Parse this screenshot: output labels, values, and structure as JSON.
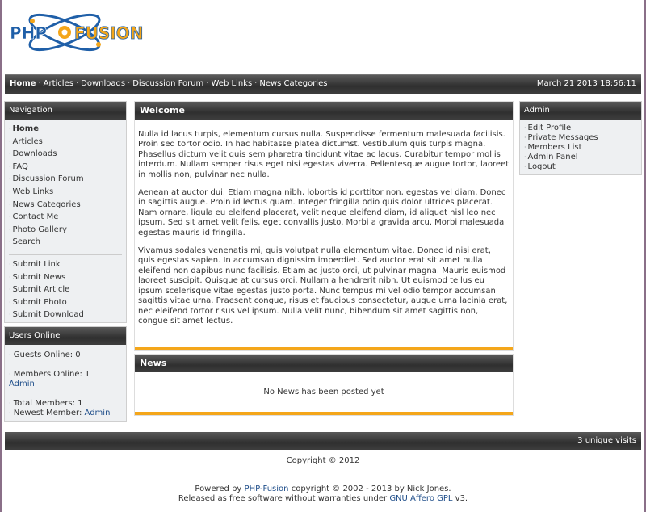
{
  "logo": {
    "part1": "PHP",
    "part2": "FUSION",
    "icon": "atom-logo-icon"
  },
  "topbar": {
    "links": [
      "Home",
      "Articles",
      "Downloads",
      "Discussion Forum",
      "Web Links",
      "News Categories"
    ],
    "date": "March 21 2013 18:56:11"
  },
  "navigation": {
    "title": "Navigation",
    "items": [
      "Home",
      "Articles",
      "Downloads",
      "FAQ",
      "Discussion Forum",
      "Web Links",
      "News Categories",
      "Contact Me",
      "Photo Gallery",
      "Search"
    ],
    "submit_items": [
      "Submit Link",
      "Submit News",
      "Submit Article",
      "Submit Photo",
      "Submit Download"
    ]
  },
  "users_online": {
    "title": "Users Online",
    "guests": "Guests Online: 0",
    "members": "Members Online: 1",
    "member_name": "Admin",
    "total": "Total Members: 1",
    "newest_label": "Newest Member:",
    "newest_name": "Admin"
  },
  "welcome": {
    "title": "Welcome",
    "paragraphs": [
      "Nulla id lacus turpis, elementum cursus nulla. Suspendisse fermentum malesuada facilisis. Proin sed tortor odio. In hac habitasse platea dictumst. Vestibulum quis turpis magna. Phasellus dictum velit quis sem pharetra tincidunt vitae ac lacus. Curabitur tempor mollis interdum. Nullam semper risus eget nisi egestas viverra. Pellentesque augue tortor, laoreet in mollis non, pulvinar nec nulla.",
      "Aenean at auctor dui. Etiam magna nibh, lobortis id porttitor non, egestas vel diam. Donec in sagittis augue. Proin id lectus quam. Integer fringilla odio quis dolor ultrices placerat. Nam ornare, ligula eu eleifend placerat, velit neque eleifend diam, id aliquet nisl leo nec ipsum. Sed sit amet velit felis, eget convallis justo. Morbi a gravida arcu. Morbi malesuada egestas mauris id fringilla.",
      "Vivamus sodales venenatis mi, quis volutpat nulla elementum vitae. Donec id nisi erat, quis egestas sapien. In accumsan dignissim imperdiet. Sed auctor erat sit amet nulla eleifend non dapibus nunc facilisis. Etiam ac justo orci, ut pulvinar magna. Mauris euismod laoreet suscipit. Quisque at cursus orci. Nullam a hendrerit nibh. Ut euismod tellus eu ipsum scelerisque vitae egestas justo porta. Nunc tempus mi vel odio tempor accumsan sagittis vitae urna. Praesent congue, risus et faucibus consectetur, augue urna lacinia erat, nec eleifend tortor risus vel ipsum. Nulla velit nunc, bibendum sit amet sagittis non, congue sit amet lectus."
    ]
  },
  "news": {
    "title": "News",
    "empty": "No News has been posted yet"
  },
  "admin": {
    "title": "Admin",
    "items": [
      "Edit Profile",
      "Private Messages",
      "Members List",
      "Admin Panel",
      "Logout"
    ]
  },
  "footer": {
    "visits": "3 unique visits",
    "copyright": "Copyright © 2012",
    "powered_prefix": "Powered by",
    "powered_link": "PHP-Fusion",
    "powered_suffix": "copyright © 2002 - 2013 by Nick Jones.",
    "released_prefix": "Released as free software without warranties under",
    "released_link": "GNU Affero GPL",
    "released_suffix": "v3."
  },
  "colors": {
    "accent": "#f4a61a",
    "bar": "#3a3a3a",
    "link": "#1f4e8a"
  }
}
